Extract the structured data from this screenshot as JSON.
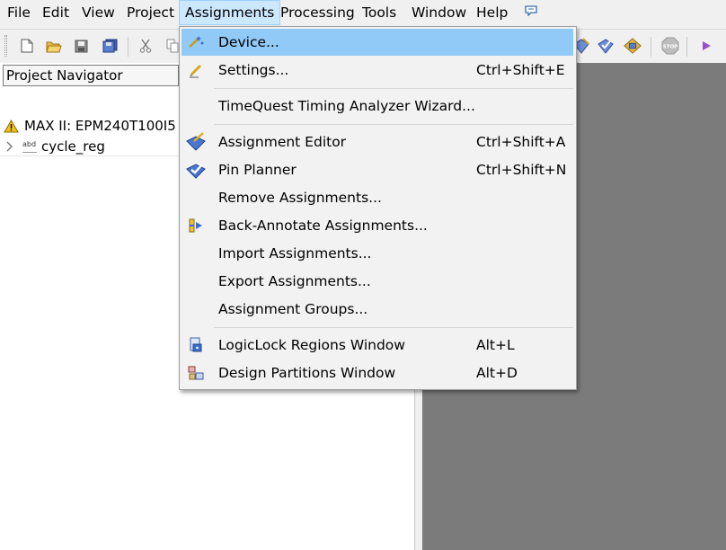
{
  "menubar": {
    "items": [
      "File",
      "Edit",
      "View",
      "Project",
      "Assignments",
      "Processing",
      "Tools",
      "Window",
      "Help"
    ],
    "active": "Assignments",
    "extra_icon": "chat-bubble-icon"
  },
  "toolbar": {
    "icons": [
      "new-file-icon",
      "open-folder-icon",
      "save-icon",
      "save-all-icon",
      "cut-icon",
      "copy-icon",
      "compile-pin-icon",
      "pin-planner-icon",
      "chip-icon",
      "stop-icon",
      "start-icon"
    ],
    "stop_label": "STOP"
  },
  "navigator": {
    "header": "Project Navigator",
    "device": "MAX II: EPM240T100I5",
    "entity": "cycle_reg",
    "entity_icon_text": "abd"
  },
  "menu": {
    "items": [
      {
        "label": "Device...",
        "shortcut": "",
        "icon": "device-wand-icon",
        "highlighted": true
      },
      {
        "label": "Settings...",
        "shortcut": "Ctrl+Shift+E",
        "icon": "settings-pencil-icon"
      },
      {
        "label": "TimeQuest Timing Analyzer Wizard...",
        "shortcut": "",
        "icon": ""
      },
      {
        "label": "Assignment Editor",
        "shortcut": "Ctrl+Shift+A",
        "icon": "assignment-editor-icon"
      },
      {
        "label": "Pin Planner",
        "shortcut": "Ctrl+Shift+N",
        "icon": "pin-planner-icon"
      },
      {
        "label": "Remove Assignments...",
        "shortcut": "",
        "icon": ""
      },
      {
        "label": "Back-Annotate Assignments...",
        "shortcut": "",
        "icon": "back-annotate-icon"
      },
      {
        "label": "Import Assignments...",
        "shortcut": "",
        "icon": ""
      },
      {
        "label": "Export Assignments...",
        "shortcut": "",
        "icon": ""
      },
      {
        "label": "Assignment Groups...",
        "shortcut": "",
        "icon": ""
      },
      {
        "label": "LogicLock Regions Window",
        "shortcut": "Alt+L",
        "icon": "logiclock-icon"
      },
      {
        "label": "Design Partitions Window",
        "shortcut": "Alt+D",
        "icon": "design-partitions-icon"
      }
    ]
  }
}
